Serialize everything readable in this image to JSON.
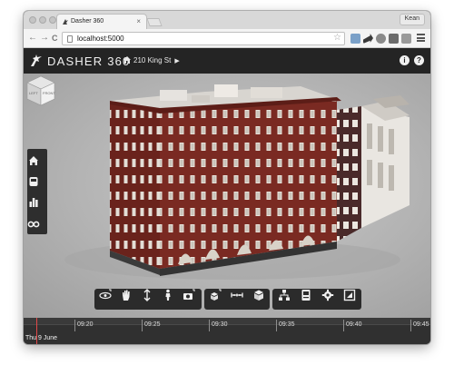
{
  "browser": {
    "tab_title": "Dasher 360",
    "tab_close": "×",
    "profile_name": "Kean",
    "url": "localhost:5000",
    "back": "←",
    "forward": "→",
    "reload": "C",
    "bookmark_star": "☆"
  },
  "app": {
    "brand": "DASHER 360",
    "breadcrumb_location": "210 King St",
    "info_button": "i",
    "help_button": "?",
    "header_bg": "#242424",
    "accent_brick": "#7a2a22"
  },
  "left_toolbar": {
    "items": [
      {
        "icon": "home-icon"
      },
      {
        "icon": "sensor-icon"
      },
      {
        "icon": "bar-chart-icon"
      },
      {
        "icon": "glasses-icon"
      }
    ]
  },
  "bottom_toolbar": {
    "groups": [
      {
        "items": [
          "orbit-icon",
          "pan-hand-icon",
          "zoom-arrows-icon",
          "first-person-icon",
          "camera-icon"
        ]
      },
      {
        "items": [
          "explode-icon",
          "measure-icon",
          "section-cube-icon"
        ]
      },
      {
        "items": [
          "model-browser-icon",
          "properties-icon",
          "settings-gear-icon",
          "fullscreen-icon"
        ]
      }
    ]
  },
  "viewcube": {
    "face_left": "LEFT",
    "face_front": "FRONT"
  },
  "timeline": {
    "ticks": [
      "09:20",
      "09:25",
      "09:30",
      "09:35",
      "09:40",
      "09:45"
    ],
    "date_label": "Thu 9 June",
    "cursor_color": "#e04848"
  }
}
